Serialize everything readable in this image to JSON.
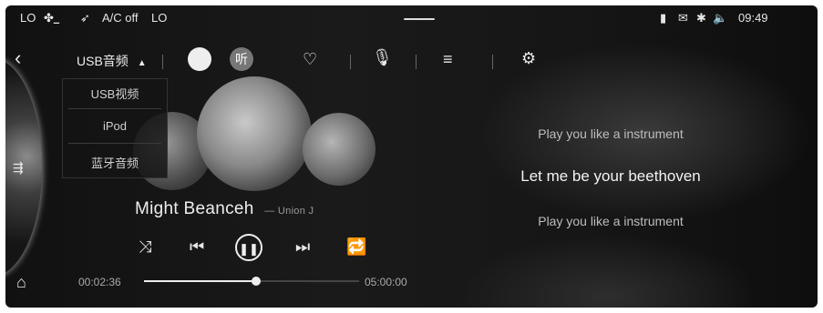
{
  "status_bar": {
    "left_temp": "LO",
    "ac_status": "A/C off",
    "right_temp": "LO",
    "time": "09:49"
  },
  "source": {
    "selected": "USB音频",
    "options": [
      "USB视频",
      "iPod",
      "蓝牙音频"
    ]
  },
  "app_icon_label": "听",
  "song": {
    "title": "Might Beanceh",
    "artist": "— Union J"
  },
  "lyrics": {
    "prev": "Play you like a instrument",
    "current": "Let me be your beethoven",
    "next": "Play you like a instrument"
  },
  "progress": {
    "elapsed": "00:02:36",
    "total": "05:00:00",
    "fraction": 0.52
  }
}
